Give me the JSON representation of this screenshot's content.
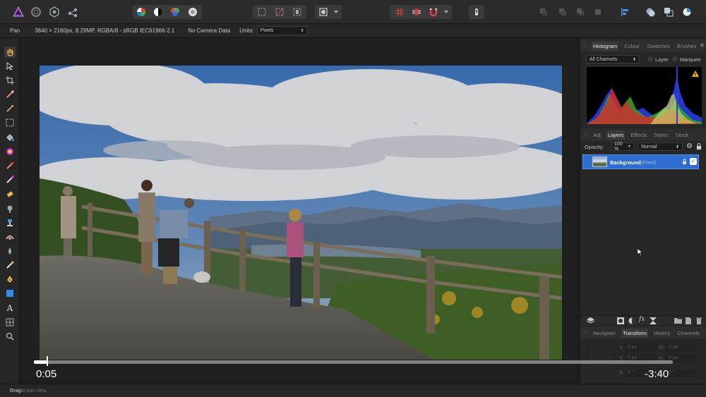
{
  "context_bar": {
    "tool_name": "Pan",
    "doc_info": "3840 × 2160px, 8.29MP, RGBA/8 - sRGB IEC61966-2.1",
    "camera": "No Camera Data",
    "units_label": "Units:",
    "units_value": "Pixels"
  },
  "panel_top": {
    "tabs": [
      "Histogram",
      "Colour",
      "Swatches",
      "Brushes"
    ],
    "active_tab": 0,
    "channels_value": "All Channels",
    "layer_label": "Layer",
    "marquee_label": "Marquee",
    "warning_icon": "warning-icon"
  },
  "panel_layers": {
    "tabs": [
      "Adj",
      "Layers",
      "Effects",
      "Styles",
      "Stock"
    ],
    "active_tab": 1,
    "opacity_label": "Opacity:",
    "opacity_value": "100 %",
    "blend_mode": "Normal",
    "layer_name": "Background",
    "layer_type": "(Pixel)"
  },
  "panel_bottom": {
    "tabs": [
      "Navigator",
      "Transform",
      "History",
      "Channels"
    ],
    "active_tab": 1,
    "x_label": "X:",
    "x_value": "0 px",
    "y_label": "Y:",
    "y_value": "0 px",
    "w_label": "W:",
    "w_value": "0 px",
    "h_label": "H:",
    "h_value": "0 px",
    "r_label": "R:",
    "r_value": "0 °",
    "s_label": "S:",
    "s_value": "0 °"
  },
  "status": {
    "bold": "Drag",
    "rest": " to pan view."
  },
  "video": {
    "elapsed": "0:05",
    "remaining": "-3:40",
    "progress": 0.02
  },
  "colors": {
    "accent": "#2f6dd0",
    "toolbar": "#2b2b2b",
    "panel": "#262626",
    "canvas": "#1f1f1f"
  }
}
